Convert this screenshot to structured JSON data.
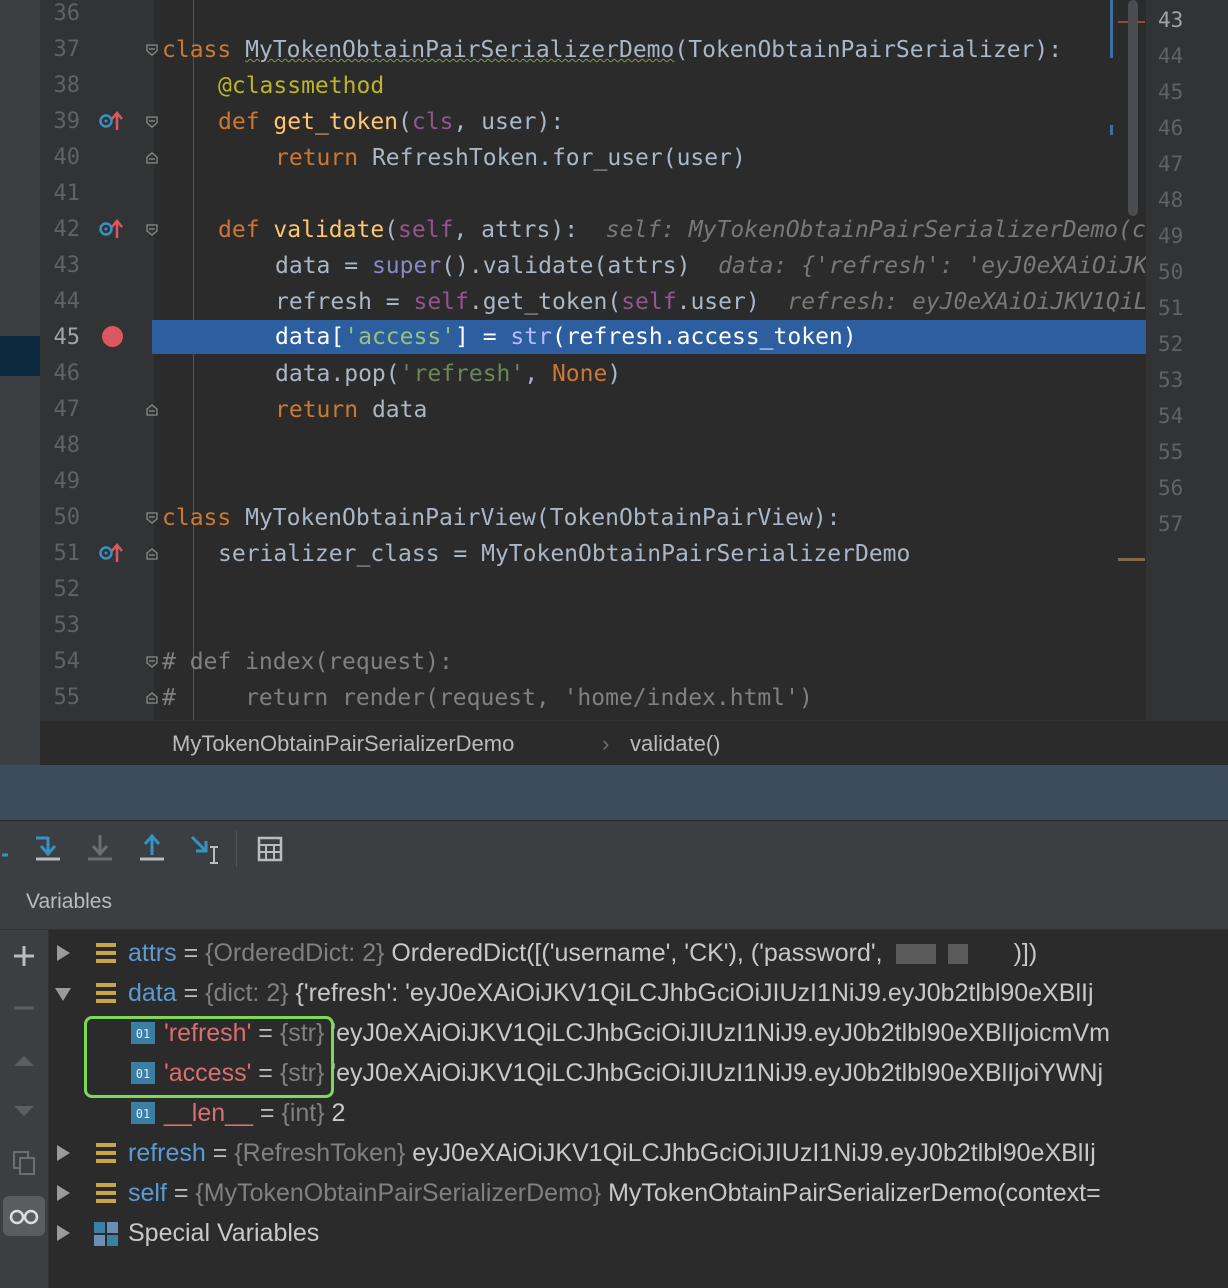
{
  "editor": {
    "lines": [
      {
        "n": "36"
      },
      {
        "n": "37"
      },
      {
        "n": "38"
      },
      {
        "n": "39"
      },
      {
        "n": "40"
      },
      {
        "n": "41"
      },
      {
        "n": "42"
      },
      {
        "n": "43"
      },
      {
        "n": "44"
      },
      {
        "n": "45"
      },
      {
        "n": "46"
      },
      {
        "n": "47"
      },
      {
        "n": "48"
      },
      {
        "n": "49"
      },
      {
        "n": "50"
      },
      {
        "n": "51"
      },
      {
        "n": "52"
      },
      {
        "n": "53"
      },
      {
        "n": "54"
      },
      {
        "n": "55"
      }
    ],
    "code": {
      "l37_kw": "class",
      "l37_name": "MyTokenObtainPairSerializerDemo",
      "l37_rest": "(TokenObtainPairSerializer):",
      "l38": "@classmethod",
      "l39_kw": "def",
      "l39_fn": "get_token",
      "l39_a": "(",
      "l39_cls": "cls",
      "l39_b": ", user):",
      "l40_kw": "return",
      "l40_rest": " RefreshToken.for_user(user)",
      "l42_kw": "def",
      "l42_fn": "validate",
      "l42_a": "(",
      "l42_self": "self",
      "l42_b": ", attrs):",
      "l42_hint": "self: MyTokenObtainPairSerializerDemo(c",
      "l43_a": "data = ",
      "l43_super": "super",
      "l43_b": "().validate(attrs)",
      "l43_hint": "data: {'refresh': 'eyJ0eXAiOiJK",
      "l44_a": "refresh = ",
      "l44_self1": "self",
      "l44_b": ".get_token(",
      "l44_self2": "self",
      "l44_c": ".user)",
      "l44_hint": "refresh: eyJ0eXAiOiJKV1QiL",
      "l45_a": "data[",
      "l45_str": "'access'",
      "l45_b": "] = ",
      "l45_builtin": "str",
      "l45_c": "(refresh.access_token)",
      "l46_a": "data.pop(",
      "l46_str": "'refresh'",
      "l46_b": ", ",
      "l46_none": "None",
      "l46_c": ")",
      "l47_kw": "return",
      "l47_rest": " data",
      "l50_kw": "class",
      "l50_rest": " MyTokenObtainPairView(TokenObtainPairView):",
      "l51": "serializer_class = MyTokenObtainPairSerializerDemo",
      "l54": "# def index(request):",
      "l55": "#     return render(request, 'home/index.html')"
    },
    "right_lines": [
      "43",
      "44",
      "45",
      "46",
      "47",
      "48",
      "49",
      "50",
      "51",
      "52",
      "53",
      "54",
      "55",
      "56",
      "57"
    ]
  },
  "breadcrumb": {
    "class_name": "MyTokenObtainPairSerializerDemo",
    "separator": "›",
    "method": "validate()"
  },
  "debugger": {
    "variables_title": "Variables",
    "vars": {
      "attrs_name": "attrs",
      "attrs_eq": " = ",
      "attrs_type": "{OrderedDict: 2}",
      "attrs_val": " OrderedDict([('username', 'CK'), ('password', ",
      "attrs_tail": ")])",
      "data_name": "data",
      "data_eq": " = ",
      "data_type": "{dict: 2}",
      "data_val": " {'refresh': 'eyJ0eXAiOiJKV1QiLCJhbGciOiJIUzI1NiJ9.eyJ0b2tlbl90eXBlIj",
      "refresh_key": "'refresh'",
      "refresh_eq": " = ",
      "refresh_type": "{str}",
      "refresh_val": " 'eyJ0eXAiOiJKV1QiLCJhbGciOiJIUzI1NiJ9.eyJ0b2tlbl90eXBlIjoicmVm",
      "access_key": "'access'",
      "access_eq": " = ",
      "access_type": "{str}",
      "access_val": " 'eyJ0eXAiOiJKV1QiLCJhbGciOiJIUzI1NiJ9.eyJ0b2tlbl90eXBlIjoiYWNj",
      "len_key": "__len__",
      "len_eq": " = ",
      "len_type": "{int}",
      "len_val": " 2",
      "refreshvar_name": "refresh",
      "refreshvar_eq": " = ",
      "refreshvar_type": "{RefreshToken}",
      "refreshvar_val": " eyJ0eXAiOiJKV1QiLCJhbGciOiJIUzI1NiJ9.eyJ0b2tlbl90eXBlIj",
      "self_name": "self",
      "self_eq": " = ",
      "self_type": "{MyTokenObtainPairSerializerDemo}",
      "self_val": " MyTokenObtainPairSerializerDemo(context=",
      "special": "Special Variables"
    }
  },
  "colors": {
    "breakpoint": "#db5860",
    "current_line": "#2d5fa0",
    "highlight_box": "#7ed957"
  }
}
